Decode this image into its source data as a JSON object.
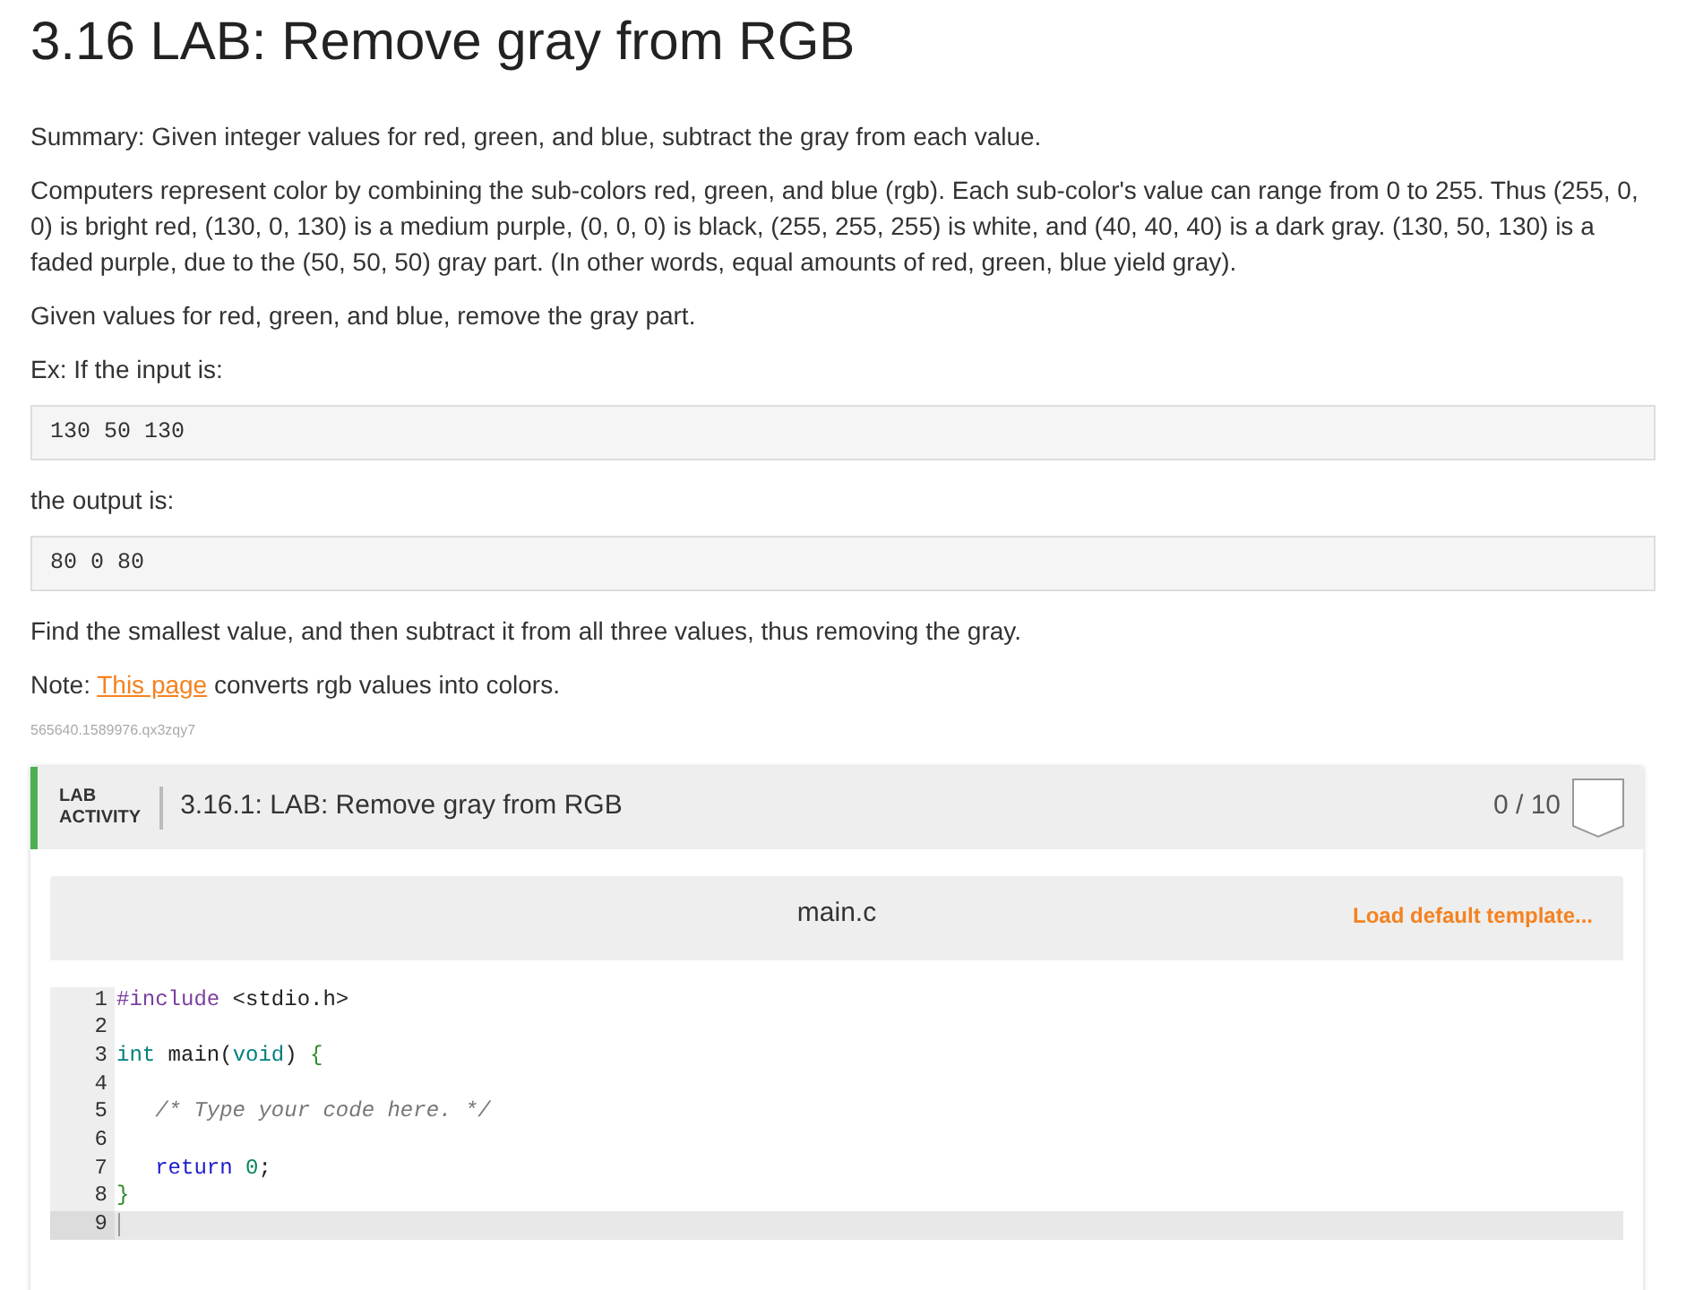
{
  "title": "3.16 LAB: Remove gray from RGB",
  "paragraphs": [
    {
      "kind": "text",
      "text": "Summary: Given integer values for red, green, and blue, subtract the gray from each value."
    },
    {
      "kind": "text",
      "text": "Computers represent color by combining the sub-colors red, green, and blue (rgb). Each sub-color's value can range from 0 to 255. Thus (255, 0, 0) is bright red, (130, 0, 130) is a medium purple, (0, 0, 0) is black, (255, 255, 255) is white, and (40, 40, 40) is a dark gray. (130, 50, 130) is a faded purple, due to the (50, 50, 50) gray part. (In other words, equal amounts of red, green, blue yield gray)."
    },
    {
      "kind": "text",
      "text": "Given values for red, green, and blue, remove the gray part."
    },
    {
      "kind": "text",
      "text": "Ex: If the input is:"
    },
    {
      "kind": "code",
      "text": "130 50 130"
    },
    {
      "kind": "text",
      "text": "the output is:"
    },
    {
      "kind": "code",
      "text": "80 0 80"
    },
    {
      "kind": "text",
      "text": "Find the smallest value, and then subtract it from all three values, thus removing the gray."
    },
    {
      "kind": "link_text",
      "before": "Note: ",
      "link": "This page",
      "after": " converts rgb values into colors."
    }
  ],
  "activity_id": "565640.1589976.qx3zqy7",
  "lab": {
    "label_top": "LAB",
    "label_bottom": "ACTIVITY",
    "title": "3.16.1: LAB: Remove gray from RGB",
    "score": "0 / 10",
    "editor": {
      "filename": "main.c",
      "action": "Load default template...",
      "lines": [
        {
          "number": "1",
          "selected": false,
          "tokens": [
            {
              "kind": "directive",
              "text": "#include"
            },
            {
              "kind": "plain",
              "text": " <stdio.h>"
            }
          ]
        },
        {
          "number": "2",
          "selected": false
        },
        {
          "number": "3",
          "selected": false,
          "tokens": [
            {
              "kind": "type",
              "text": "int"
            },
            {
              "kind": "plain",
              "text": " main("
            },
            {
              "kind": "type",
              "text": "void"
            },
            {
              "kind": "plain",
              "text": ") "
            },
            {
              "kind": "bracket",
              "text": "{"
            }
          ]
        },
        {
          "number": "4",
          "selected": false
        },
        {
          "number": "5",
          "selected": false,
          "tokens": [
            {
              "kind": "comment",
              "text": "   /* Type your code here. */"
            }
          ]
        },
        {
          "number": "6",
          "selected": false
        },
        {
          "number": "7",
          "selected": false,
          "tokens": [
            {
              "kind": "keyword",
              "text": "   return"
            },
            {
              "kind": "number",
              "text": " 0"
            },
            {
              "kind": "plain",
              "text": ";"
            }
          ]
        },
        {
          "number": "8",
          "selected": false,
          "tokens": [
            {
              "kind": "bracket",
              "text": "}"
            }
          ]
        },
        {
          "number": "9",
          "selected": true
        }
      ]
    }
  }
}
